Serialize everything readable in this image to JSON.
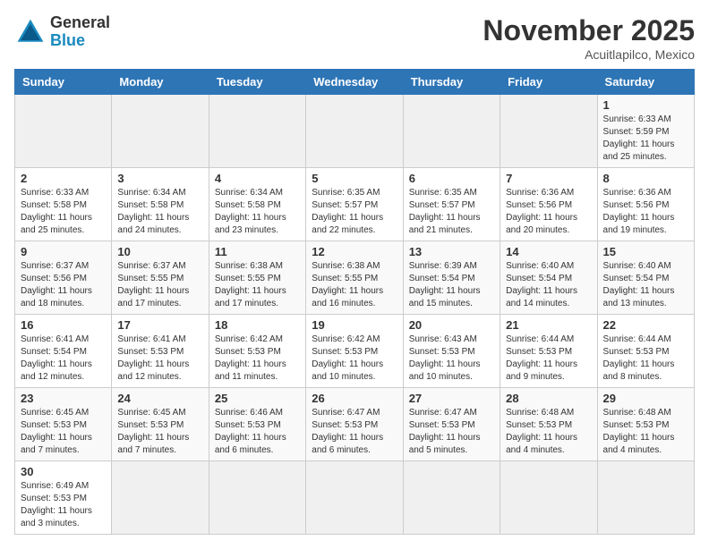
{
  "header": {
    "logo_general": "General",
    "logo_blue": "Blue",
    "month_year": "November 2025",
    "location": "Acuitlapilco, Mexico"
  },
  "days_of_week": [
    "Sunday",
    "Monday",
    "Tuesday",
    "Wednesday",
    "Thursday",
    "Friday",
    "Saturday"
  ],
  "weeks": [
    [
      {
        "day": "",
        "info": ""
      },
      {
        "day": "",
        "info": ""
      },
      {
        "day": "",
        "info": ""
      },
      {
        "day": "",
        "info": ""
      },
      {
        "day": "",
        "info": ""
      },
      {
        "day": "",
        "info": ""
      },
      {
        "day": "1",
        "info": "Sunrise: 6:33 AM\nSunset: 5:59 PM\nDaylight: 11 hours and 25 minutes."
      }
    ],
    [
      {
        "day": "2",
        "info": "Sunrise: 6:33 AM\nSunset: 5:58 PM\nDaylight: 11 hours and 25 minutes."
      },
      {
        "day": "3",
        "info": "Sunrise: 6:34 AM\nSunset: 5:58 PM\nDaylight: 11 hours and 24 minutes."
      },
      {
        "day": "4",
        "info": "Sunrise: 6:34 AM\nSunset: 5:58 PM\nDaylight: 11 hours and 23 minutes."
      },
      {
        "day": "5",
        "info": "Sunrise: 6:35 AM\nSunset: 5:57 PM\nDaylight: 11 hours and 22 minutes."
      },
      {
        "day": "6",
        "info": "Sunrise: 6:35 AM\nSunset: 5:57 PM\nDaylight: 11 hours and 21 minutes."
      },
      {
        "day": "7",
        "info": "Sunrise: 6:36 AM\nSunset: 5:56 PM\nDaylight: 11 hours and 20 minutes."
      },
      {
        "day": "8",
        "info": "Sunrise: 6:36 AM\nSunset: 5:56 PM\nDaylight: 11 hours and 19 minutes."
      }
    ],
    [
      {
        "day": "9",
        "info": "Sunrise: 6:37 AM\nSunset: 5:56 PM\nDaylight: 11 hours and 18 minutes."
      },
      {
        "day": "10",
        "info": "Sunrise: 6:37 AM\nSunset: 5:55 PM\nDaylight: 11 hours and 17 minutes."
      },
      {
        "day": "11",
        "info": "Sunrise: 6:38 AM\nSunset: 5:55 PM\nDaylight: 11 hours and 17 minutes."
      },
      {
        "day": "12",
        "info": "Sunrise: 6:38 AM\nSunset: 5:55 PM\nDaylight: 11 hours and 16 minutes."
      },
      {
        "day": "13",
        "info": "Sunrise: 6:39 AM\nSunset: 5:54 PM\nDaylight: 11 hours and 15 minutes."
      },
      {
        "day": "14",
        "info": "Sunrise: 6:40 AM\nSunset: 5:54 PM\nDaylight: 11 hours and 14 minutes."
      },
      {
        "day": "15",
        "info": "Sunrise: 6:40 AM\nSunset: 5:54 PM\nDaylight: 11 hours and 13 minutes."
      }
    ],
    [
      {
        "day": "16",
        "info": "Sunrise: 6:41 AM\nSunset: 5:54 PM\nDaylight: 11 hours and 12 minutes."
      },
      {
        "day": "17",
        "info": "Sunrise: 6:41 AM\nSunset: 5:53 PM\nDaylight: 11 hours and 12 minutes."
      },
      {
        "day": "18",
        "info": "Sunrise: 6:42 AM\nSunset: 5:53 PM\nDaylight: 11 hours and 11 minutes."
      },
      {
        "day": "19",
        "info": "Sunrise: 6:42 AM\nSunset: 5:53 PM\nDaylight: 11 hours and 10 minutes."
      },
      {
        "day": "20",
        "info": "Sunrise: 6:43 AM\nSunset: 5:53 PM\nDaylight: 11 hours and 10 minutes."
      },
      {
        "day": "21",
        "info": "Sunrise: 6:44 AM\nSunset: 5:53 PM\nDaylight: 11 hours and 9 minutes."
      },
      {
        "day": "22",
        "info": "Sunrise: 6:44 AM\nSunset: 5:53 PM\nDaylight: 11 hours and 8 minutes."
      }
    ],
    [
      {
        "day": "23",
        "info": "Sunrise: 6:45 AM\nSunset: 5:53 PM\nDaylight: 11 hours and 7 minutes."
      },
      {
        "day": "24",
        "info": "Sunrise: 6:45 AM\nSunset: 5:53 PM\nDaylight: 11 hours and 7 minutes."
      },
      {
        "day": "25",
        "info": "Sunrise: 6:46 AM\nSunset: 5:53 PM\nDaylight: 11 hours and 6 minutes."
      },
      {
        "day": "26",
        "info": "Sunrise: 6:47 AM\nSunset: 5:53 PM\nDaylight: 11 hours and 6 minutes."
      },
      {
        "day": "27",
        "info": "Sunrise: 6:47 AM\nSunset: 5:53 PM\nDaylight: 11 hours and 5 minutes."
      },
      {
        "day": "28",
        "info": "Sunrise: 6:48 AM\nSunset: 5:53 PM\nDaylight: 11 hours and 4 minutes."
      },
      {
        "day": "29",
        "info": "Sunrise: 6:48 AM\nSunset: 5:53 PM\nDaylight: 11 hours and 4 minutes."
      }
    ],
    [
      {
        "day": "30",
        "info": "Sunrise: 6:49 AM\nSunset: 5:53 PM\nDaylight: 11 hours and 3 minutes."
      },
      {
        "day": "",
        "info": ""
      },
      {
        "day": "",
        "info": ""
      },
      {
        "day": "",
        "info": ""
      },
      {
        "day": "",
        "info": ""
      },
      {
        "day": "",
        "info": ""
      },
      {
        "day": "",
        "info": ""
      }
    ]
  ]
}
